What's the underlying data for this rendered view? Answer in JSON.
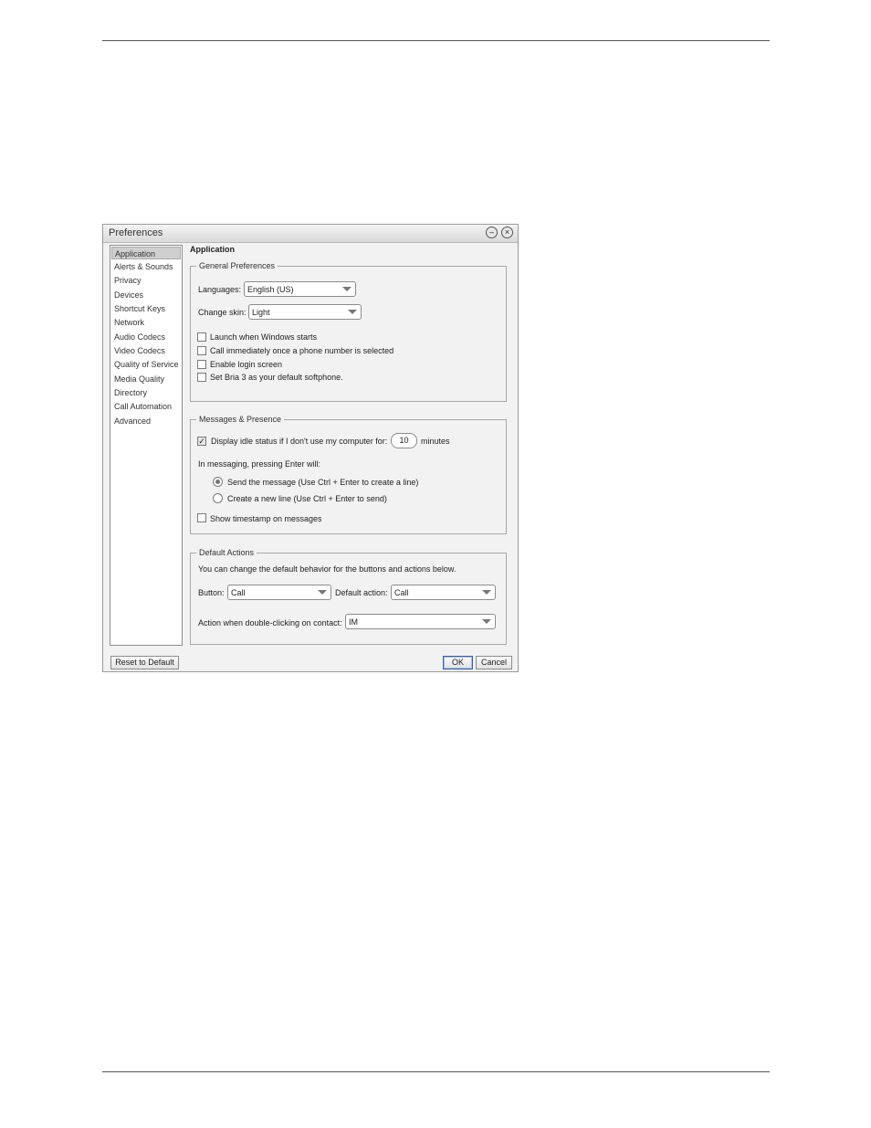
{
  "window": {
    "title": "Preferences"
  },
  "sidebar": {
    "items": [
      {
        "label": "Application"
      },
      {
        "label": "Alerts & Sounds"
      },
      {
        "label": "Privacy"
      },
      {
        "label": "Devices"
      },
      {
        "label": "Shortcut Keys"
      },
      {
        "label": "Network"
      },
      {
        "label": "Audio Codecs"
      },
      {
        "label": "Video Codecs"
      },
      {
        "label": "Quality of Service"
      },
      {
        "label": "Media Quality"
      },
      {
        "label": "Directory"
      },
      {
        "label": "Call Automation"
      },
      {
        "label": "Advanced"
      }
    ],
    "selected": "Application"
  },
  "panel": {
    "title": "Application"
  },
  "general": {
    "legend": "General Preferences",
    "languages_label": "Languages:",
    "languages_value": "English (US)",
    "skin_label": "Change skin:",
    "skin_value": "Light",
    "checkboxes": [
      {
        "label": "Launch when Windows starts",
        "checked": false
      },
      {
        "label": "Call immediately once a phone number is selected",
        "checked": false
      },
      {
        "label": "Enable login screen",
        "checked": false
      },
      {
        "label": "Set Bria 3 as your default softphone.",
        "checked": false
      }
    ]
  },
  "messages": {
    "legend": "Messages & Presence",
    "idle_label": "Display idle status if I don't use my computer for:",
    "idle_checked": true,
    "idle_minutes": "10",
    "idle_unit": "minutes",
    "enter_label": "In messaging, pressing Enter will:",
    "enter_options": [
      {
        "label": "Send the message (Use Ctrl + Enter to create a line)",
        "checked": true
      },
      {
        "label": "Create a new line (Use Ctrl + Enter to send)",
        "checked": false
      }
    ],
    "timestamp_label": "Show timestamp on messages",
    "timestamp_checked": false
  },
  "actions": {
    "legend": "Default Actions",
    "description": "You can change the default behavior for the buttons and actions below.",
    "button_label": "Button:",
    "button_value": "Call",
    "default_action_label": "Default action:",
    "default_action_value": "Call",
    "double_click_label": "Action when double-clicking on contact:",
    "double_click_value": "IM"
  },
  "footer": {
    "reset_label": "Reset to Default",
    "ok_label": "OK",
    "cancel_label": "Cancel"
  }
}
